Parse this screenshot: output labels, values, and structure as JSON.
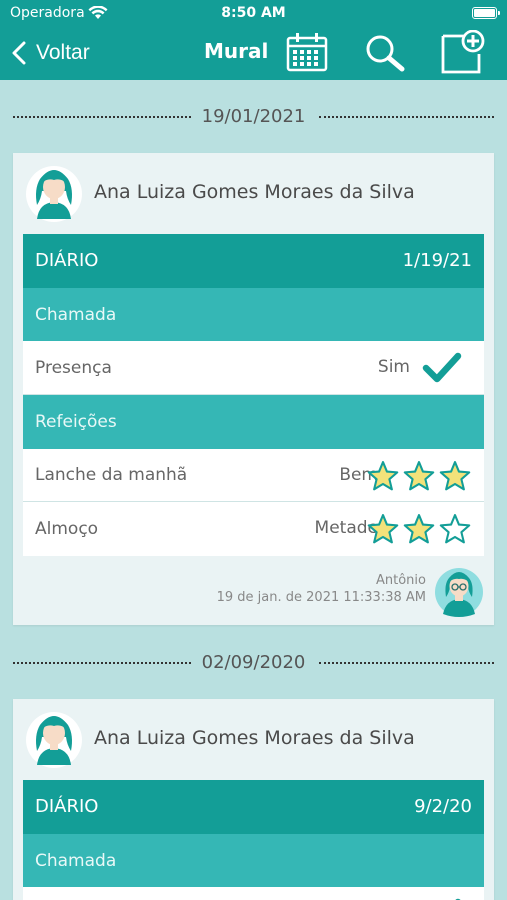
{
  "status_bar": {
    "carrier": "Operadora",
    "time": "8:50 AM"
  },
  "nav": {
    "back_label": "Voltar",
    "title": "Mural"
  },
  "colors": {
    "primary": "#139e97",
    "secondary": "#35b7b5",
    "background": "#b9e0e0",
    "star": "#f3e27a"
  },
  "posts": [
    {
      "date": "19/01/2021",
      "student": "Ana Luiza Gomes Moraes da Silva",
      "header": "DIÁRIO",
      "header_date": "1/19/21",
      "sections": {
        "chamada": {
          "title": "Chamada",
          "presence_label": "Presença",
          "presence_value": "Sim"
        },
        "refeicoes": {
          "title": "Refeições",
          "items": [
            {
              "label": "Lanche da manhã",
              "value": "Bem",
              "stars": 3
            },
            {
              "label": "Almoço",
              "value": "Metade",
              "stars": 2
            }
          ]
        }
      },
      "author": "Antônio",
      "timestamp": "19 de jan. de 2021 11:33:38 AM"
    },
    {
      "date": "02/09/2020",
      "student": "Ana Luiza Gomes Moraes da Silva",
      "header": "DIÁRIO",
      "header_date": "9/2/20",
      "sections": {
        "chamada": {
          "title": "Chamada"
        }
      }
    }
  ]
}
